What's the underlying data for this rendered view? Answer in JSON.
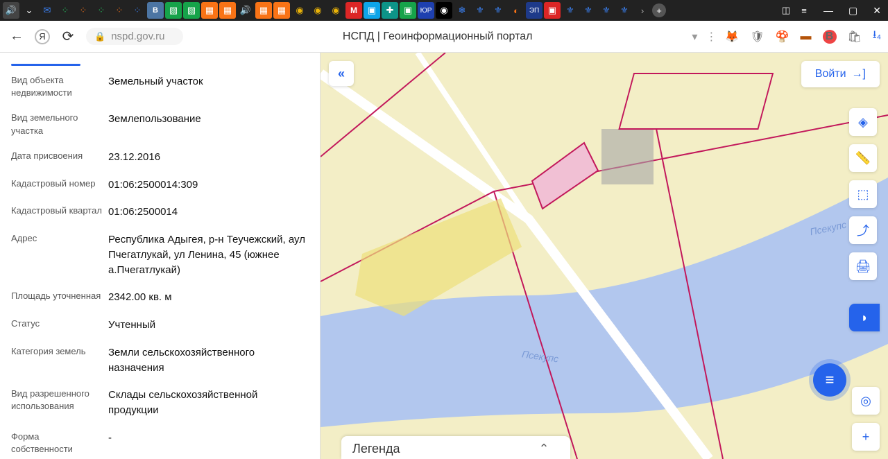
{
  "browser": {
    "url": "nspd.gov.ru",
    "page_title": "НСПД | Геоинформационный портал"
  },
  "login_label": "Войти",
  "legend_label": "Легенда",
  "river_name": "Псекупс",
  "props": {
    "object_type": {
      "label": "Вид объекта недвижимости",
      "value": "Земельный участок"
    },
    "land_type": {
      "label": "Вид земельного участка",
      "value": "Землепользование"
    },
    "assign_date": {
      "label": "Дата присвоения",
      "value": "23.12.2016"
    },
    "cad_number": {
      "label": "Кадастровый номер",
      "value": "01:06:2500014:309"
    },
    "cad_block": {
      "label": "Кадастровый квартал",
      "value": "01:06:2500014"
    },
    "address": {
      "label": "Адрес",
      "value": "Республика Адыгея, р-н Теучежский, аул Пчегатлукай, ул Ленина, 45 (южнее а.Пчегатлукай)"
    },
    "area": {
      "label": "Площадь уточненная",
      "value": "2342.00 кв. м"
    },
    "status": {
      "label": "Статус",
      "value": "Учтенный"
    },
    "land_category": {
      "label": "Категория земель",
      "value": "Земли сельскохозяйственного назначения"
    },
    "permitted_use": {
      "label": "Вид разрешенного использования",
      "value": "Склады сельскохозяйственной продукции"
    },
    "ownership": {
      "label": "Форма собственности",
      "value": "-"
    }
  }
}
